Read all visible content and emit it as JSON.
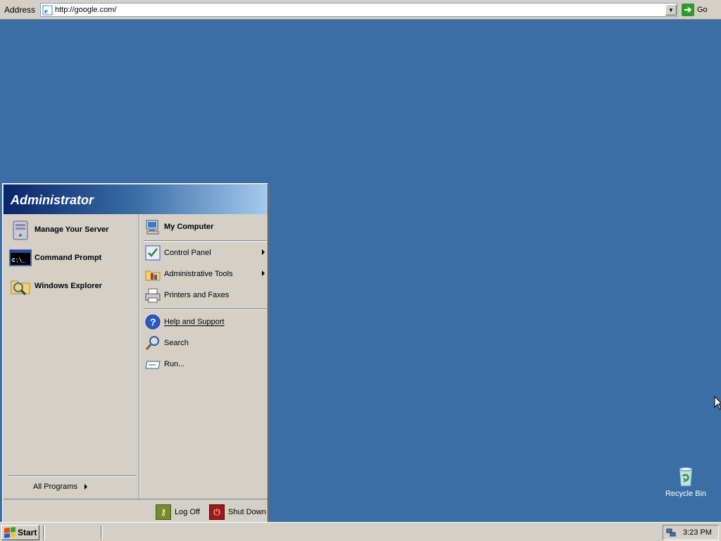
{
  "address_bar": {
    "label": "Address",
    "url": "http://google.com/",
    "go_label": "Go",
    "icon": "ie-page-icon"
  },
  "start_menu": {
    "user_name": "Administrator",
    "pinned": [
      {
        "label": "Manage Your Server",
        "icon": "manage-server-icon"
      },
      {
        "label": "Command Prompt",
        "icon": "command-prompt-icon"
      },
      {
        "label": "Windows Explorer",
        "icon": "windows-explorer-icon"
      }
    ],
    "all_programs": "All Programs",
    "right": {
      "my_computer": "My Computer",
      "control_panel": "Control Panel",
      "admin_tools": "Administrative Tools",
      "printers": "Printers and Faxes",
      "help": "Help and Support",
      "search": "Search",
      "run": "Run..."
    },
    "log_off": "Log Off",
    "shut_down": "Shut Down"
  },
  "taskbar": {
    "start_label": "Start",
    "clock": "3:23 PM"
  },
  "desktop": {
    "recycle_bin": "Recycle Bin",
    "background_color": "#3a6ea5"
  }
}
